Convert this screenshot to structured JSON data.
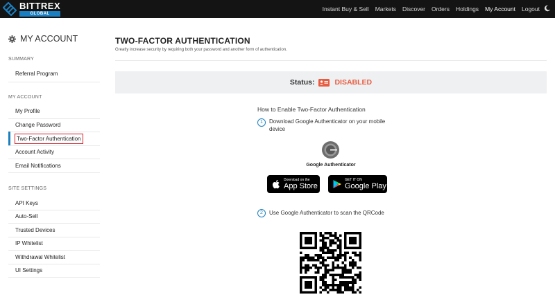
{
  "brand": {
    "name": "BITTREX",
    "sub": "GLOBAL"
  },
  "nav": {
    "items": [
      "Instant Buy & Sell",
      "Markets",
      "Discover",
      "Orders",
      "Holdings",
      "My Account",
      "Logout"
    ],
    "active": "My Account"
  },
  "sidebar": {
    "title": "MY ACCOUNT",
    "sections": [
      {
        "label": "SUMMARY",
        "items": [
          "Referral Program"
        ]
      },
      {
        "label": "MY ACCOUNT",
        "items": [
          "My Profile",
          "Change Password",
          "Two-Factor Authentication",
          "Account Activity",
          "Email Notifications"
        ]
      },
      {
        "label": "SITE SETTINGS",
        "items": [
          "API Keys",
          "Auto-Sell",
          "Trusted Devices",
          "IP Whitelist",
          "Withdrawal Whitelist",
          "UI Settings"
        ]
      }
    ],
    "selected": "Two-Factor Authentication"
  },
  "main": {
    "title": "TWO-FACTOR AUTHENTICATION",
    "subtitle": "Greatly increase security by requiring both your password and another form of authentication.",
    "status_label": "Status:",
    "status_value": "DISABLED",
    "howto": "How to Enable Two-Factor Authentication",
    "steps": [
      {
        "num": "1",
        "text": "Download Google Authenticator on your mobile device"
      },
      {
        "num": "2",
        "text": "Use Google Authenticator to scan the QRCode"
      }
    ],
    "app_name": "Google Authenticator",
    "app_store": {
      "small": "Download on the",
      "big": "App Store"
    },
    "google_play": {
      "small": "GET IT ON",
      "big": "Google Play"
    }
  },
  "colors": {
    "accent": "#1a7fc0",
    "status_disabled": "#e85c41",
    "topbar": "#141414",
    "highlight_border": "#d0202a"
  },
  "icons": [
    "bittrex-logo-icon",
    "moon-icon",
    "gear-icon",
    "id-card-icon",
    "google-authenticator-icon",
    "apple-icon",
    "google-play-icon",
    "qr-code"
  ]
}
